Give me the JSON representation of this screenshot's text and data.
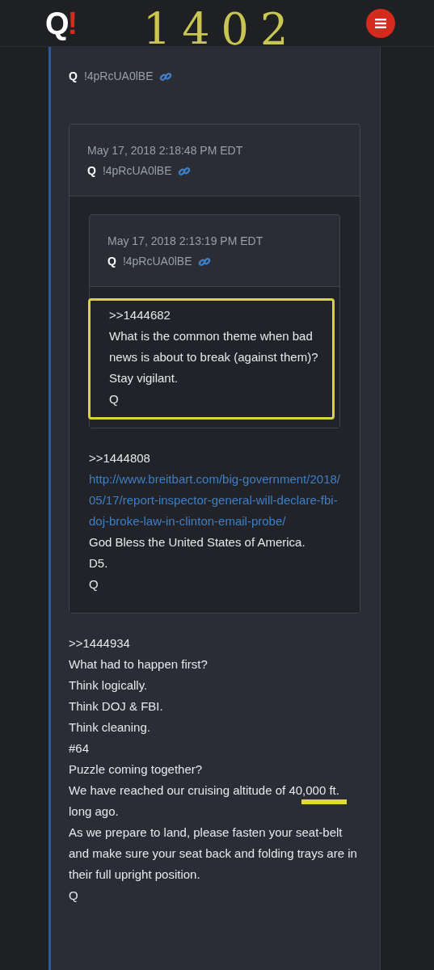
{
  "header": {
    "logo": "Q",
    "logo_mark": "!",
    "annotation": "1402"
  },
  "post": {
    "author": "Q",
    "tripcode": "!4pRcUA0lBE",
    "quote": {
      "date": "May 17, 2018 2:18:48 PM EDT",
      "author": "Q",
      "tripcode": "!4pRcUA0lBE",
      "quote": {
        "date": "May 17, 2018 2:13:19 PM EDT",
        "author": "Q",
        "tripcode": "!4pRcUA0lBE",
        "highlighted": true,
        "lines": [
          {
            "kind": "text",
            "text": ">>1444682"
          },
          {
            "kind": "text",
            "text": "What is the common theme when bad news is about to break (against them)?"
          },
          {
            "kind": "text",
            "text": "Stay vigilant."
          },
          {
            "kind": "text",
            "text": "Q"
          }
        ]
      },
      "lines": [
        {
          "kind": "text",
          "text": ">>1444808"
        },
        {
          "kind": "link",
          "text": "http://www.breitbart.com/big-government/2018/05/17/report-inspector-general-will-declare-fbi-doj-broke-law-in-clinton-email-probe/"
        },
        {
          "kind": "text",
          "text": "God Bless the United States of America."
        },
        {
          "kind": "text",
          "text": "D5."
        },
        {
          "kind": "text",
          "text": "Q"
        }
      ]
    },
    "lines": [
      {
        "kind": "text",
        "text": ">>1444934"
      },
      {
        "kind": "text",
        "text": "What had to happen first?"
      },
      {
        "kind": "text",
        "text": "Think logically."
      },
      {
        "kind": "text",
        "text": "Think DOJ & FBI."
      },
      {
        "kind": "text",
        "text": "Think cleaning."
      },
      {
        "kind": "text",
        "text": "#64"
      },
      {
        "kind": "text",
        "text": "Puzzle coming together?"
      },
      {
        "kind": "underlined",
        "text": "We have reached our cruising altitude of 40,000 ft. long ago."
      },
      {
        "kind": "text",
        "text": "As we prepare to land, please fasten your seat-belt and make sure your seat back and folding trays are in their full upright position."
      },
      {
        "kind": "text",
        "text": "Q"
      }
    ]
  }
}
